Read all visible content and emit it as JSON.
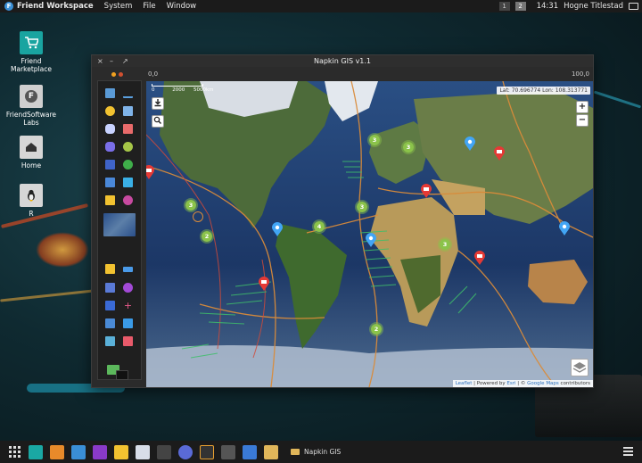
{
  "topbar": {
    "app_name": "Friend Workspace",
    "menus": [
      "System",
      "File",
      "Window"
    ],
    "workspaces": [
      "1",
      "2"
    ],
    "active_workspace": "2",
    "time": "14:31",
    "user": "Hogne Titlestad"
  },
  "desktop": {
    "icons": [
      {
        "label": "Friend Marketplace",
        "icon": "cart-icon"
      },
      {
        "label": "FriendSoftware Labs",
        "icon": "friend-logo-icon"
      },
      {
        "label": "Home",
        "icon": "home-icon"
      },
      {
        "label": "R",
        "icon": "linux-penguin-icon"
      }
    ]
  },
  "window": {
    "title": "Napkin GIS v1.1",
    "controls": [
      "×",
      "–",
      "↗"
    ],
    "coord_left": "0,0",
    "coord_right": "100,0"
  },
  "map": {
    "scale_labels": [
      "0",
      "2000",
      "5000km"
    ],
    "latlon": "Lat: 70.696774 Lon: 108.313771",
    "zoom_in": "+",
    "zoom_out": "−",
    "attribution": {
      "leaflet": "Leaflet",
      "powered": " | Powered by ",
      "esri": "Esri",
      "sep": " | © ",
      "google": "Google Maps",
      "tail": " contributors"
    },
    "clusters": [
      "3",
      "3",
      "3",
      "2",
      "4",
      "3",
      "3",
      "2"
    ],
    "colors": {
      "cluster": "#8bc34a",
      "pin_red": "#e53935",
      "pin_blue": "#42a5f5",
      "plate_line": "#d98b3a"
    }
  },
  "taskbar": {
    "running_app": "Napkin GIS",
    "launchers": [
      "grid-icon",
      "deepin-icon",
      "slides-icon",
      "calendar-icon",
      "tv-icon",
      "notes-icon",
      "document-icon",
      "settings-icon",
      "globe-icon",
      "terminal-icon",
      "gears-icon",
      "apps-icon",
      "folder-icon"
    ]
  }
}
